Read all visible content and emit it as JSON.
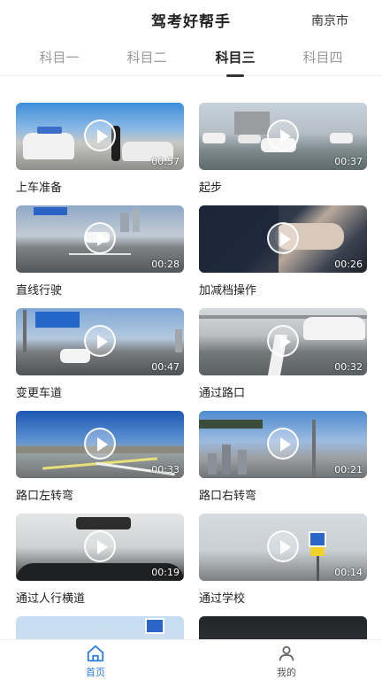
{
  "header": {
    "title": "驾考好帮手",
    "city": "南京市"
  },
  "tabs": [
    {
      "label": "科目一",
      "active": false
    },
    {
      "label": "科目二",
      "active": false
    },
    {
      "label": "科目三",
      "active": true
    },
    {
      "label": "科目四",
      "active": false
    }
  ],
  "videos": [
    {
      "title": "上车准备",
      "duration": "00:57"
    },
    {
      "title": "起步",
      "duration": "00:37"
    },
    {
      "title": "直线行驶",
      "duration": "00:28"
    },
    {
      "title": "加减档操作",
      "duration": "00:26"
    },
    {
      "title": "变更车道",
      "duration": "00:47"
    },
    {
      "title": "通过路口",
      "duration": "00:32"
    },
    {
      "title": "路口左转弯",
      "duration": "00:33"
    },
    {
      "title": "路口右转弯",
      "duration": "00:21"
    },
    {
      "title": "通过人行横道",
      "duration": "00:19"
    },
    {
      "title": "通过学校",
      "duration": "00:14"
    },
    {
      "title": "",
      "duration": ""
    },
    {
      "title": "",
      "duration": ""
    }
  ],
  "bottom_nav": {
    "home_label": "首页",
    "mine_label": "我的"
  },
  "colors": {
    "accent": "#2c7be5",
    "active_text": "#222222",
    "inactive_text": "#9a9a9a"
  },
  "icons": {
    "home": "home-icon",
    "mine": "user-icon",
    "play": "play-icon"
  }
}
